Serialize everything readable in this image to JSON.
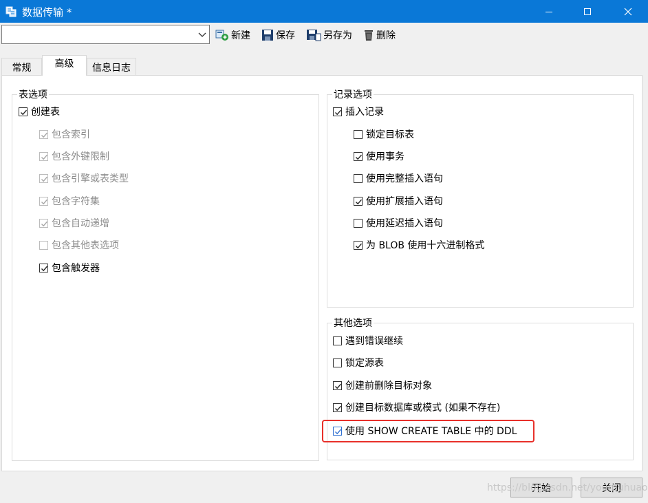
{
  "window": {
    "title": "数据传输 *",
    "minimize_icon": "minimize-icon",
    "maximize_icon": "maximize-icon",
    "close_icon": "close-icon"
  },
  "toolbar": {
    "profile_combo_value": "",
    "new_label": "新建",
    "save_label": "保存",
    "save_as_label": "另存为",
    "delete_label": "删除"
  },
  "tabs": [
    {
      "label": "常规",
      "active": false
    },
    {
      "label": "高级",
      "active": true
    },
    {
      "label": "信息日志",
      "active": false
    }
  ],
  "table_options": {
    "title": "表选项",
    "items": [
      {
        "label": "创建表",
        "checked": true,
        "enabled": true
      },
      {
        "label": "包含索引",
        "checked": true,
        "enabled": false
      },
      {
        "label": "包含外键限制",
        "checked": true,
        "enabled": false
      },
      {
        "label": "包含引擎或表类型",
        "checked": true,
        "enabled": false
      },
      {
        "label": "包含字符集",
        "checked": true,
        "enabled": false
      },
      {
        "label": "包含自动递增",
        "checked": true,
        "enabled": false
      },
      {
        "label": "包含其他表选项",
        "checked": false,
        "enabled": false
      },
      {
        "label": "包含触发器",
        "checked": true,
        "enabled": true
      }
    ]
  },
  "record_options": {
    "title": "记录选项",
    "items": [
      {
        "label": "插入记录",
        "checked": true,
        "enabled": true
      },
      {
        "label": "锁定目标表",
        "checked": false,
        "enabled": true
      },
      {
        "label": "使用事务",
        "checked": true,
        "enabled": true
      },
      {
        "label": "使用完整插入语句",
        "checked": false,
        "enabled": true
      },
      {
        "label": "使用扩展插入语句",
        "checked": true,
        "enabled": true
      },
      {
        "label": "使用延迟插入语句",
        "checked": false,
        "enabled": true
      },
      {
        "label": "为 BLOB 使用十六进制格式",
        "checked": true,
        "enabled": true
      }
    ]
  },
  "other_options": {
    "title": "其他选项",
    "items": [
      {
        "label": "遇到错误继续",
        "checked": false,
        "enabled": true
      },
      {
        "label": "锁定源表",
        "checked": false,
        "enabled": true
      },
      {
        "label": "创建前删除目标对象",
        "checked": true,
        "enabled": true
      },
      {
        "label": "创建目标数据库或模式 (如果不存在)",
        "checked": true,
        "enabled": true
      },
      {
        "label": "使用 SHOW CREATE TABLE 中的 DDL",
        "checked": true,
        "enabled": true,
        "highlighted": true
      }
    ]
  },
  "footer": {
    "start_label": "开始",
    "close_label": "关闭",
    "watermark": "https://blog.csdn.net/yourhuhuao"
  },
  "colors": {
    "titlebar": "#0a78d7",
    "highlight_border": "#e8302a",
    "check_blue": "#2e6fd1"
  }
}
